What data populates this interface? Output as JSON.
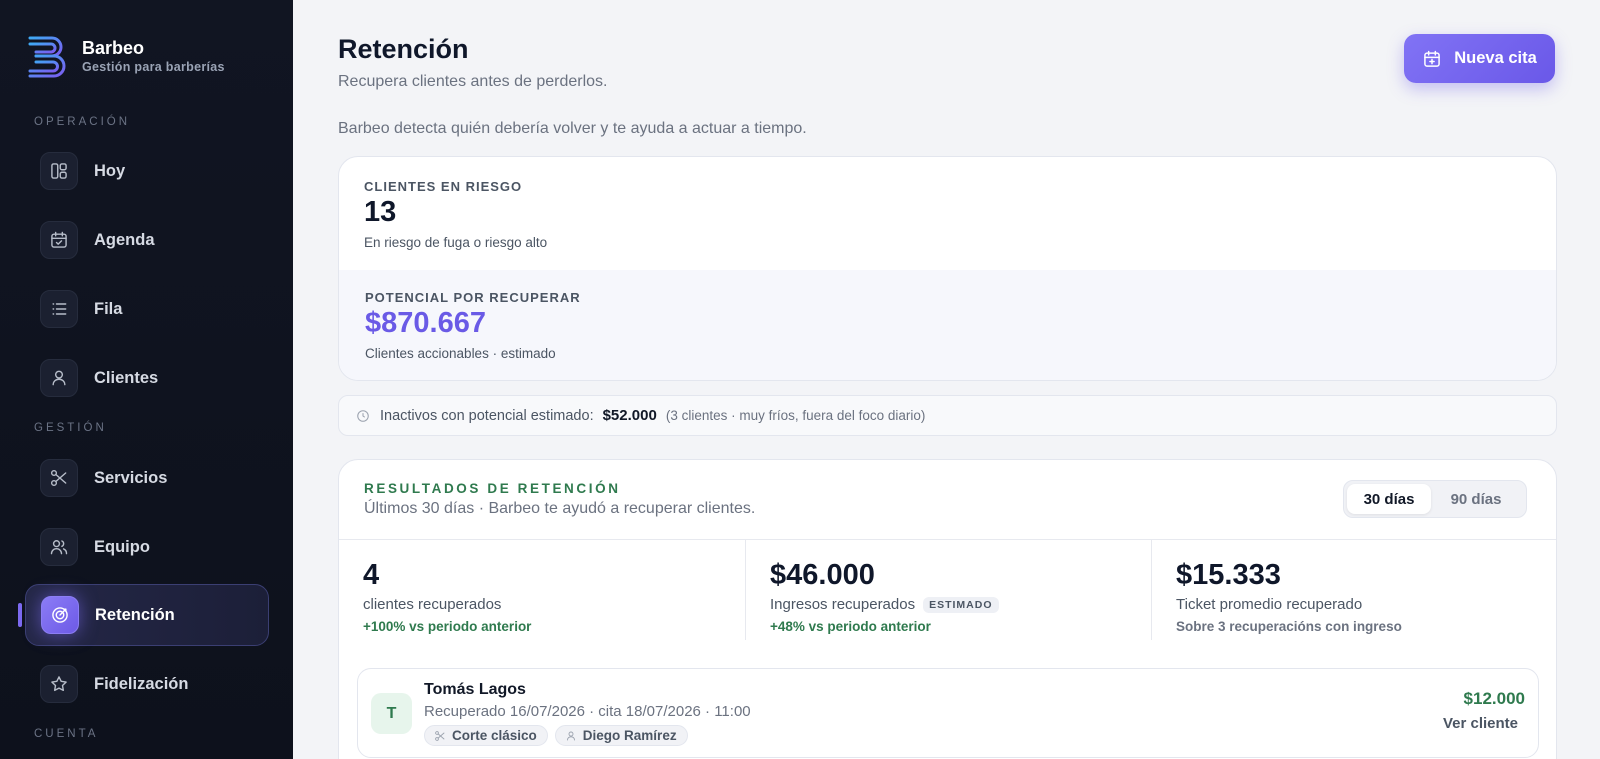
{
  "brand": {
    "name": "Barbeo",
    "subtitle": "Gestión para barberías"
  },
  "sidebar": {
    "sections": {
      "operacion": "OPERACIÓN",
      "gestion": "GESTIÓN",
      "cuenta": "CUENTA"
    },
    "items": [
      {
        "label": "Hoy",
        "icon": "dashboard-icon"
      },
      {
        "label": "Agenda",
        "icon": "calendar-check-icon"
      },
      {
        "label": "Fila",
        "icon": "list-icon"
      },
      {
        "label": "Clientes",
        "icon": "user-icon"
      },
      {
        "label": "Servicios",
        "icon": "scissors-icon"
      },
      {
        "label": "Equipo",
        "icon": "users-icon"
      },
      {
        "label": "Retención",
        "icon": "target-icon",
        "active": true
      },
      {
        "label": "Fidelización",
        "icon": "star-icon"
      }
    ]
  },
  "header": {
    "title": "Retención",
    "subtitle": "Recupera clientes antes de perderlos.",
    "description": "Barbeo detecta quién debería volver y te ayuda a actuar a tiempo.",
    "new_button": "Nueva cita"
  },
  "risk": {
    "label": "CLIENTES EN RIESGO",
    "value": "13",
    "note": "En riesgo de fuga o riesgo alto",
    "potential_label": "POTENCIAL POR RECUPERAR",
    "potential_value": "$870.667",
    "potential_note": "Clientes accionables · estimado"
  },
  "inactive": {
    "label": "Inactivos con potencial estimado:",
    "amount": "$52.000",
    "detail": "(3 clientes · muy fríos, fuera del foco diario)"
  },
  "results": {
    "kicker": "RESULTADOS DE RETENCIÓN",
    "subtitle": "Últimos 30 días · Barbeo te ayudó a recuperar clientes.",
    "toggle": {
      "option_30": "30 días",
      "option_90": "90 días",
      "selected": "30 días"
    },
    "metrics": [
      {
        "value": "4",
        "label": "clientes recuperados",
        "delta": "+100% vs periodo anterior"
      },
      {
        "value": "$46.000",
        "label": "Ingresos recuperados",
        "badge": "ESTIMADO",
        "delta": "+48% vs periodo anterior"
      },
      {
        "value": "$15.333",
        "label": "Ticket promedio recuperado",
        "note": "Sobre 3 recuperacións con ingreso"
      }
    ],
    "clients": [
      {
        "initial": "T",
        "name": "Tomás Lagos",
        "meta": "Recuperado 16/07/2026 · cita 18/07/2026 · 11:00",
        "service": "Corte clásico",
        "barber": "Diego Ramírez",
        "amount": "$12.000",
        "link": "Ver cliente"
      }
    ]
  },
  "colors": {
    "accent": "#6a5ae6",
    "success": "#2f7a4e",
    "sidebar_bg": "#111522"
  }
}
